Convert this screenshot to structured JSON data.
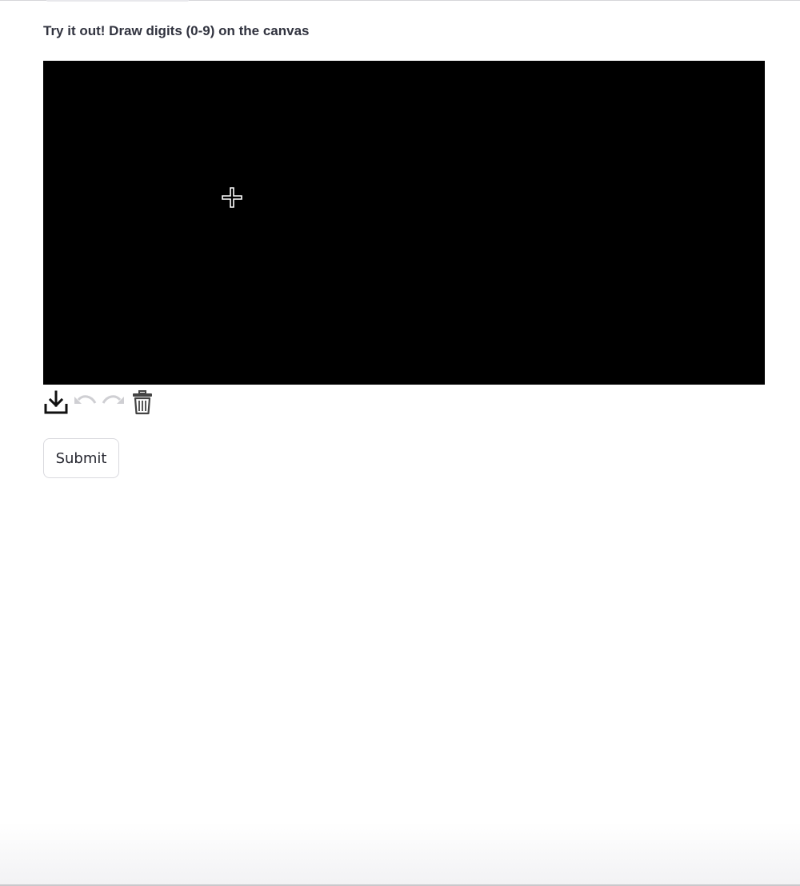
{
  "page": {
    "heading": "Try it out! Draw digits (0-9) on the canvas"
  },
  "canvas": {
    "background_color": "#000000",
    "cursor_icon": "crosshair-cursor-icon"
  },
  "toolbar": {
    "download_icon": "download-icon",
    "undo_icon": "undo-icon",
    "redo_icon": "redo-icon",
    "trash_icon": "trash-icon",
    "active_color": "#111111",
    "disabled_color": "#cfcfd3"
  },
  "form": {
    "submit_label": "Submit"
  }
}
